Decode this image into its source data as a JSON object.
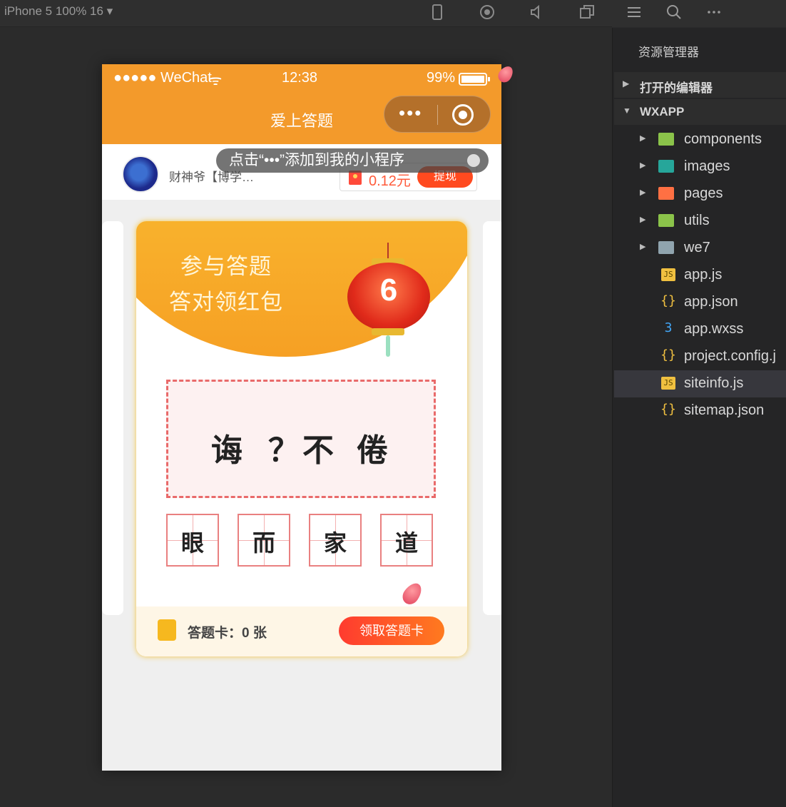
{
  "toolbar": {
    "device": "iPhone 5 100% 16 ▾"
  },
  "phone": {
    "status": {
      "signal": "●●●●● WeChat",
      "wifi": "ᯤ",
      "time": "12:38",
      "battery": "99%"
    },
    "nav_title": "爱上答题",
    "capsule_more": "•••",
    "user": {
      "name": "财神爷【",
      "name_rest": "博学…"
    },
    "balance": {
      "amount": "0.12元",
      "withdraw": "提现"
    },
    "tip": "点击“•••”添加到我的小程序",
    "card": {
      "slogan1": "参与答题",
      "slogan2": "答对领红包",
      "lantern_number": "6",
      "question_chars": [
        "诲",
        "？",
        "不",
        "倦"
      ],
      "options": [
        "眼",
        "而",
        "家",
        "道"
      ],
      "card_count": "答题卡：0 张",
      "claim_button": "领取答题卡"
    }
  },
  "explorer": {
    "title": "资源管理器",
    "sections": [
      {
        "label": "打开的编辑器",
        "expanded": false
      },
      {
        "label": "WXAPP",
        "expanded": true
      }
    ],
    "items": [
      {
        "name": "components",
        "kind": "folder",
        "color": "#8bc34a"
      },
      {
        "name": "images",
        "kind": "folder",
        "color": "#26a69a"
      },
      {
        "name": "pages",
        "kind": "folder",
        "color": "#ff7043"
      },
      {
        "name": "utils",
        "kind": "folder",
        "color": "#8bc34a"
      },
      {
        "name": "we7",
        "kind": "folder",
        "color": "#90a4ae"
      },
      {
        "name": "app.js",
        "kind": "js",
        "color": "#f0c040"
      },
      {
        "name": "app.json",
        "kind": "json",
        "color": "#f0c040"
      },
      {
        "name": "app.wxss",
        "kind": "css",
        "color": "#42a5f5"
      },
      {
        "name": "project.config.j",
        "kind": "json",
        "color": "#f0c040"
      },
      {
        "name": "siteinfo.js",
        "kind": "js",
        "color": "#f0c040",
        "selected": true
      },
      {
        "name": "sitemap.json",
        "kind": "json",
        "color": "#f0c040"
      }
    ]
  }
}
